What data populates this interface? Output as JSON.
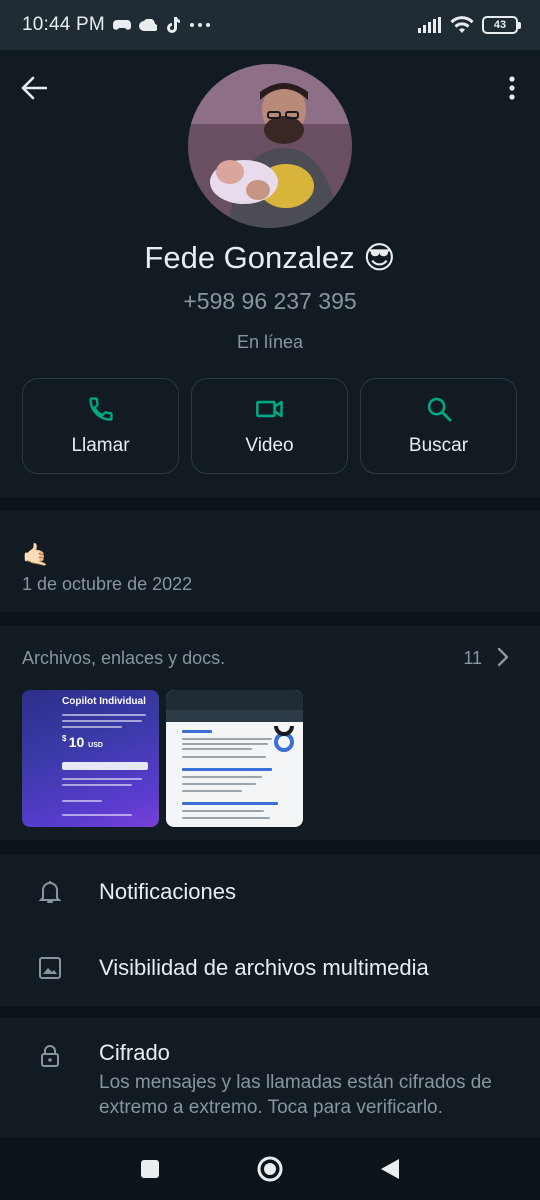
{
  "status_bar": {
    "time": "10:44 PM",
    "battery": "43"
  },
  "profile": {
    "name": "Fede Gonzalez 😎",
    "phone": "+598 96 237 395",
    "status": "En línea"
  },
  "actions": {
    "call_label": "Llamar",
    "video_label": "Video",
    "search_label": "Buscar"
  },
  "about": {
    "emoji": "🤙🏻",
    "date": "1 de octubre de 2022"
  },
  "media": {
    "title": "Archivos, enlaces y docs.",
    "count": "11",
    "thumb1_title": "Copilot Individual",
    "thumb1_price": "10",
    "thumb1_currency": "USD"
  },
  "settings": {
    "notifications_label": "Notificaciones",
    "media_visibility_label": "Visibilidad de archivos multimedia",
    "encryption_title": "Cifrado",
    "encryption_desc": "Los mensajes y las llamadas están cifrados de extremo a extremo. Toca para verificarlo."
  },
  "colors": {
    "accent": "#00a884",
    "background": "#121b22",
    "divider": "#0b141a",
    "secondary_text": "#8696a0"
  }
}
